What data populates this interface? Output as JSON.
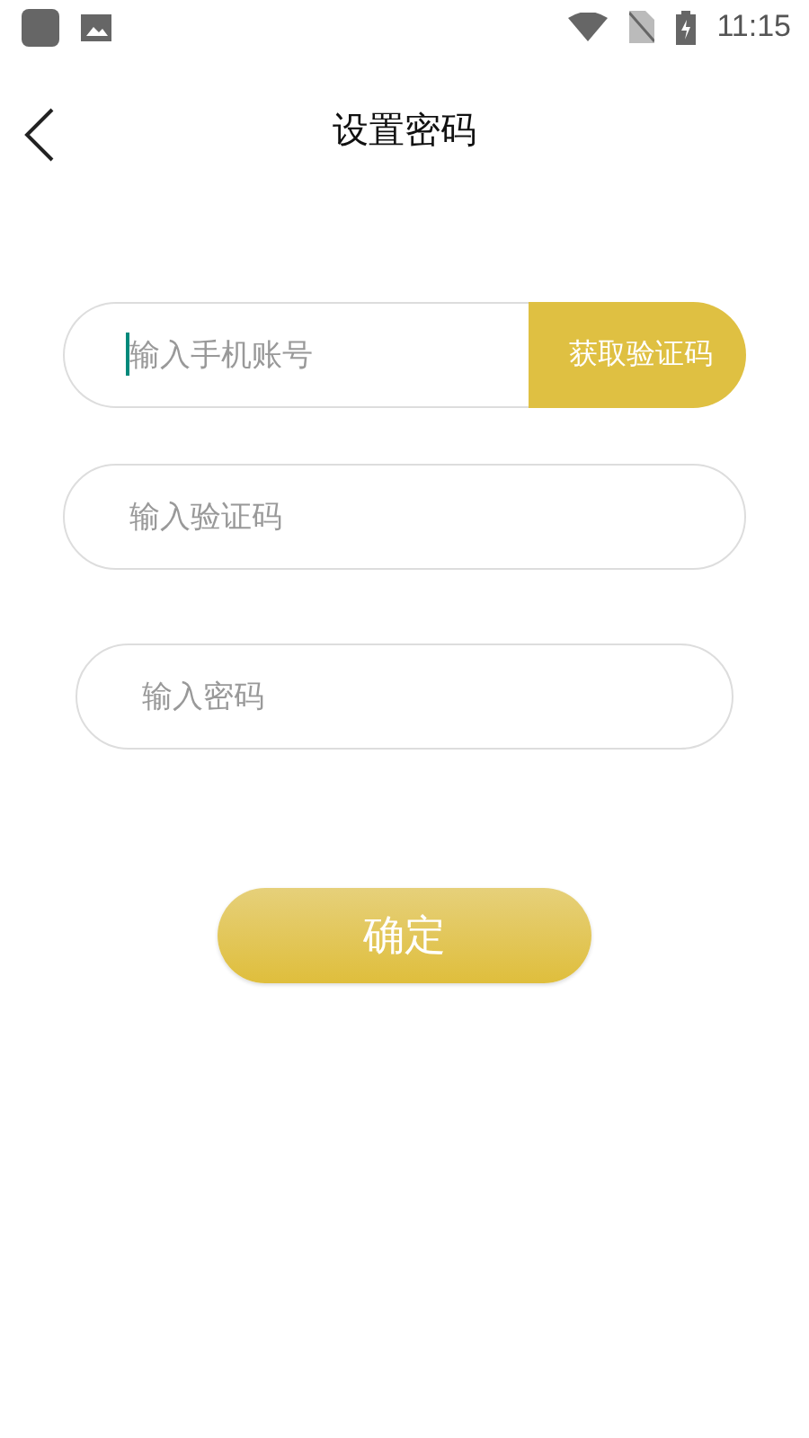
{
  "status_bar": {
    "time": "11:15"
  },
  "header": {
    "title": "设置密码"
  },
  "fields": [
    {
      "kind": "with_button",
      "placeholder": "输入手机账号",
      "focused": true,
      "button": "获取验证码"
    },
    {
      "kind": "plain",
      "placeholder": "输入验证码",
      "focused": false
    },
    {
      "kind": "narrow",
      "placeholder": "输入密码",
      "focused": false
    }
  ],
  "submit": {
    "label": "确定"
  }
}
